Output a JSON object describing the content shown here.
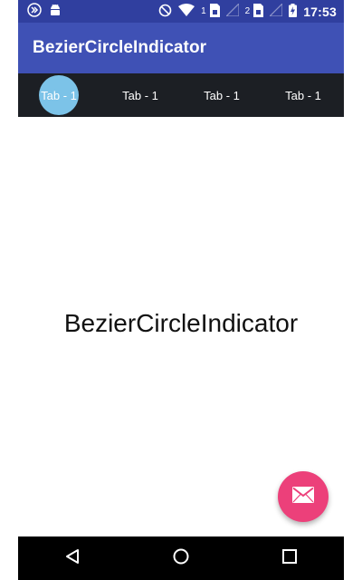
{
  "status_bar": {
    "time": "17:53",
    "sim1": "1",
    "sim2": "2",
    "icons": [
      "media-icon",
      "android-icon",
      "do-not-disturb-icon",
      "wifi-icon",
      "sim-card-icon",
      "signal-icon",
      "battery-charging-icon"
    ]
  },
  "app_bar": {
    "title": "BezierCircleIndicator",
    "color": "#3F51B5"
  },
  "tabs": [
    {
      "label": "Tab - 1"
    },
    {
      "label": "Tab - 1"
    },
    {
      "label": "Tab - 1"
    },
    {
      "label": "Tab - 1"
    }
  ],
  "selected_tab_index": 0,
  "indicator_color": "#7CC3E8",
  "content": {
    "text": "BezierCircleIndicator"
  },
  "fab": {
    "icon": "email-icon",
    "color": "#EC407A"
  },
  "nav_bar": {
    "buttons": [
      "back-icon",
      "home-icon",
      "recents-icon"
    ]
  }
}
